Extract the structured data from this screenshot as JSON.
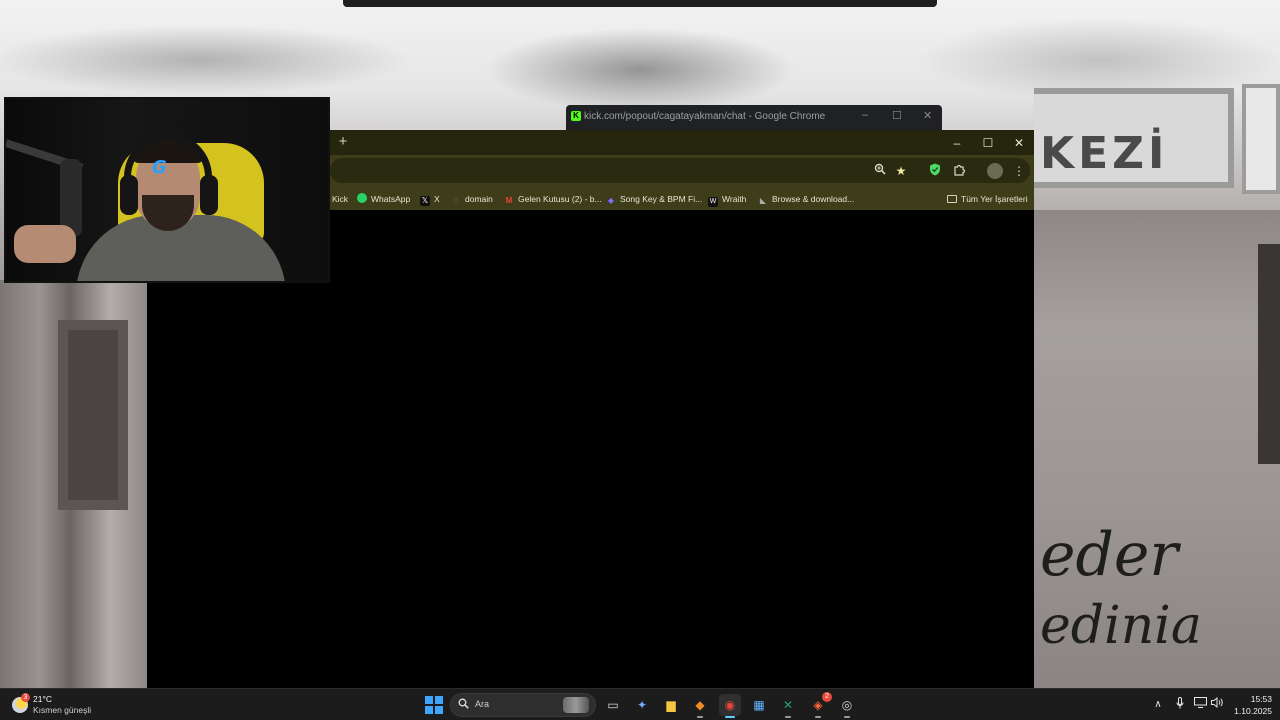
{
  "wallpaper": {
    "sign_text": "KEZİ",
    "script_line1": "eder",
    "script_line2": "edinia"
  },
  "popout_window": {
    "title": "kick.com/popout/cagatayakman/chat - Google Chrome",
    "favicon": "K",
    "minimize": "–",
    "maximize": "☐",
    "close": "✕"
  },
  "chrome": {
    "new_tab_label": "+",
    "window_controls": {
      "minimize": "–",
      "maximize": "☐",
      "close": "✕"
    },
    "toolbar_icons": [
      "zoom-icon",
      "star-icon",
      "shield-extension-icon",
      "extensions-puzzle-icon",
      "profile-icon",
      "menu-kebab-icon"
    ],
    "bookmarks": [
      {
        "label": "Kick",
        "icon": "kick-icon"
      },
      {
        "label": "WhatsApp",
        "icon": "whatsapp-icon"
      },
      {
        "label": "X",
        "icon": "x-icon"
      },
      {
        "label": "domain",
        "icon": "domain-icon"
      },
      {
        "label": "Gelen Kutusu (2) - b...",
        "icon": "gmail-icon"
      },
      {
        "label": "Song Key & BPM Fi...",
        "icon": "songkey-icon"
      },
      {
        "label": "Wraith",
        "icon": "wraith-icon"
      },
      {
        "label": "Browse & download...",
        "icon": "download-icon"
      }
    ],
    "all_bookmarks_label": "Tüm Yer İşaretleri"
  },
  "webcam": {
    "logo_text": "G"
  },
  "taskbar": {
    "weather": {
      "temp": "21°C",
      "desc": "Kısmen güneşli",
      "badge": "3"
    },
    "search_placeholder": "Ara",
    "apps": [
      {
        "name": "task-view",
        "glyph": "▭"
      },
      {
        "name": "copilot",
        "glyph": "✦"
      },
      {
        "name": "file-explorer",
        "glyph": "▆"
      },
      {
        "name": "fl-studio",
        "glyph": "◆"
      },
      {
        "name": "chrome",
        "glyph": "◉"
      },
      {
        "name": "ms-store",
        "glyph": "▦"
      },
      {
        "name": "excel",
        "glyph": "✕"
      },
      {
        "name": "game-app",
        "glyph": "◈",
        "badge": "2"
      },
      {
        "name": "steam",
        "glyph": "◎"
      }
    ],
    "clock": {
      "time": "15:53",
      "date": "1.10.2025"
    }
  },
  "colors": {
    "chrome_titlebar": "#26260f",
    "chrome_toolbar": "#3d3d19",
    "taskbar": "#1c1c1c",
    "accent": "#60cdff"
  }
}
